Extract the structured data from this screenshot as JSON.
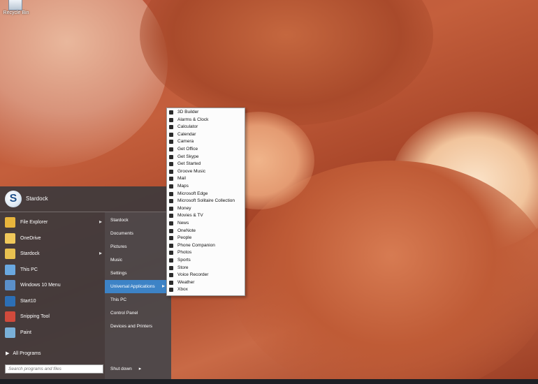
{
  "desktop": {
    "recycle_bin_label": "Recycle Bin"
  },
  "start_menu": {
    "title": "Stardock",
    "programs": [
      {
        "label": "File Explorer",
        "icon": "folder-icon",
        "color": "#e8b53c",
        "has_arrow": true
      },
      {
        "label": "OneDrive",
        "icon": "onedrive-icon",
        "color": "#f0c85a",
        "has_arrow": false
      },
      {
        "label": "Stardock",
        "icon": "folder-icon",
        "color": "#e8c050",
        "has_arrow": true
      },
      {
        "label": "This PC",
        "icon": "computer-icon",
        "color": "#6aa8e0",
        "has_arrow": false
      },
      {
        "label": "Windows 10 Menu",
        "icon": "windows-menu-icon",
        "color": "#5b8fc9",
        "has_arrow": false
      },
      {
        "label": "Start10",
        "icon": "start10-icon",
        "color": "#2c6fb6",
        "has_arrow": false
      },
      {
        "label": "Snipping Tool",
        "icon": "scissors-icon",
        "color": "#d04a3c",
        "has_arrow": false
      },
      {
        "label": "Paint",
        "icon": "paint-icon",
        "color": "#7ab0d8",
        "has_arrow": false
      }
    ],
    "all_programs": "All Programs",
    "search_placeholder": "Search programs and files",
    "places": [
      {
        "label": "Stardock",
        "has_arrow": false,
        "highlighted": false
      },
      {
        "label": "Documents",
        "has_arrow": false,
        "highlighted": false
      },
      {
        "label": "Pictures",
        "has_arrow": false,
        "highlighted": false
      },
      {
        "label": "Music",
        "has_arrow": false,
        "highlighted": false
      },
      {
        "label": "Settings",
        "has_arrow": false,
        "highlighted": false
      },
      {
        "label": "Universal Applications",
        "has_arrow": true,
        "highlighted": true
      },
      {
        "label": "This PC",
        "has_arrow": false,
        "highlighted": false
      },
      {
        "label": "Control Panel",
        "has_arrow": false,
        "highlighted": false
      },
      {
        "label": "Devices and Printers",
        "has_arrow": false,
        "highlighted": false
      }
    ],
    "shutdown_label": "Shut down",
    "highlight_color": "#3d83c6"
  },
  "universal_apps": [
    {
      "label": "3D Builder",
      "icon": "cube-icon"
    },
    {
      "label": "Alarms & Clock",
      "icon": "clock-icon"
    },
    {
      "label": "Calculator",
      "icon": "calculator-icon"
    },
    {
      "label": "Calendar",
      "icon": "calendar-icon"
    },
    {
      "label": "Camera",
      "icon": "camera-icon"
    },
    {
      "label": "Get Office",
      "icon": "office-icon"
    },
    {
      "label": "Get Skype",
      "icon": "skype-icon"
    },
    {
      "label": "Get Started",
      "icon": "lightbulb-icon"
    },
    {
      "label": "Groove Music",
      "icon": "music-icon"
    },
    {
      "label": "Mail",
      "icon": "mail-icon"
    },
    {
      "label": "Maps",
      "icon": "map-icon"
    },
    {
      "label": "Microsoft Edge",
      "icon": "edge-icon"
    },
    {
      "label": "Microsoft Solitaire Collection",
      "icon": "cards-icon"
    },
    {
      "label": "Money",
      "icon": "money-icon"
    },
    {
      "label": "Movies & TV",
      "icon": "film-icon"
    },
    {
      "label": "News",
      "icon": "news-icon"
    },
    {
      "label": "OneNote",
      "icon": "onenote-icon"
    },
    {
      "label": "People",
      "icon": "people-icon"
    },
    {
      "label": "Phone Companion",
      "icon": "phone-icon"
    },
    {
      "label": "Photos",
      "icon": "photos-icon"
    },
    {
      "label": "Sports",
      "icon": "sports-icon"
    },
    {
      "label": "Store",
      "icon": "store-icon"
    },
    {
      "label": "Voice Recorder",
      "icon": "microphone-icon"
    },
    {
      "label": "Weather",
      "icon": "weather-icon"
    },
    {
      "label": "Xbox",
      "icon": "xbox-icon"
    }
  ]
}
